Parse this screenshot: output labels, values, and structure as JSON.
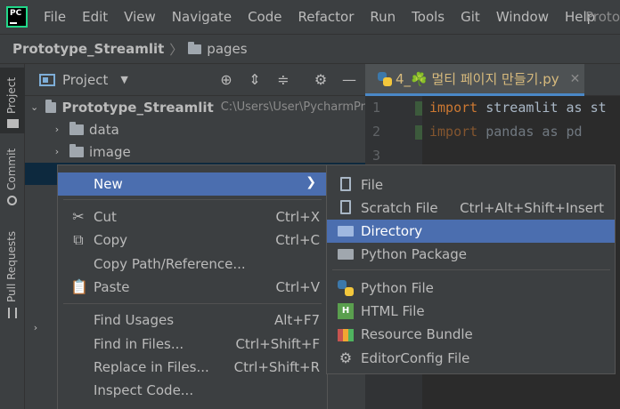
{
  "menubar": {
    "logo_text": "PC",
    "items": [
      "File",
      "Edit",
      "View",
      "Navigate",
      "Code",
      "Refactor",
      "Run",
      "Tools",
      "Git",
      "Window",
      "Help"
    ],
    "window_title": "Proto"
  },
  "navbar": {
    "project": "Prototype_Streamlit",
    "folder": "pages"
  },
  "toolstrip": {
    "project_label": "Project",
    "commit_label": "Commit",
    "pull_requests_label": "Pull Requests"
  },
  "project_panel": {
    "title": "Project",
    "root": {
      "name": "Prototype_Streamlit",
      "path": "C:\\Users\\User\\PycharmPr"
    },
    "folders": [
      "data",
      "image"
    ]
  },
  "editor": {
    "tab_title": "4_☘️ 멀티 페이지 만들기.py",
    "line_numbers": [
      "1",
      "2",
      "3"
    ],
    "lines": [
      {
        "kw": "import",
        "rest": " streamlit as st"
      },
      {
        "kw": "import",
        "rest": " pandas as pd"
      }
    ]
  },
  "context_menu": {
    "new": "New",
    "cut": {
      "label": "Cut",
      "shortcut": "Ctrl+X"
    },
    "copy": {
      "label": "Copy",
      "shortcut": "Ctrl+C"
    },
    "copy_path": "Copy Path/Reference...",
    "paste": {
      "label": "Paste",
      "shortcut": "Ctrl+V"
    },
    "find_usages": {
      "label": "Find Usages",
      "shortcut": "Alt+F7"
    },
    "find_in_files": {
      "label": "Find in Files...",
      "shortcut": "Ctrl+Shift+F"
    },
    "replace_in_files": {
      "label": "Replace in Files...",
      "shortcut": "Ctrl+Shift+R"
    },
    "inspect_code": "Inspect Code..."
  },
  "new_submenu": {
    "file": "File",
    "scratch_file": {
      "label": "Scratch File",
      "shortcut": "Ctrl+Alt+Shift+Insert"
    },
    "directory": "Directory",
    "python_package": "Python Package",
    "python_file": "Python File",
    "html_file": "HTML File",
    "resource_bundle": "Resource Bundle",
    "editorconfig_file": "EditorConfig File"
  },
  "colors": {
    "highlight": "#4b6eaf",
    "selected_row": "#0d293e",
    "keyword": "#cc7832"
  }
}
